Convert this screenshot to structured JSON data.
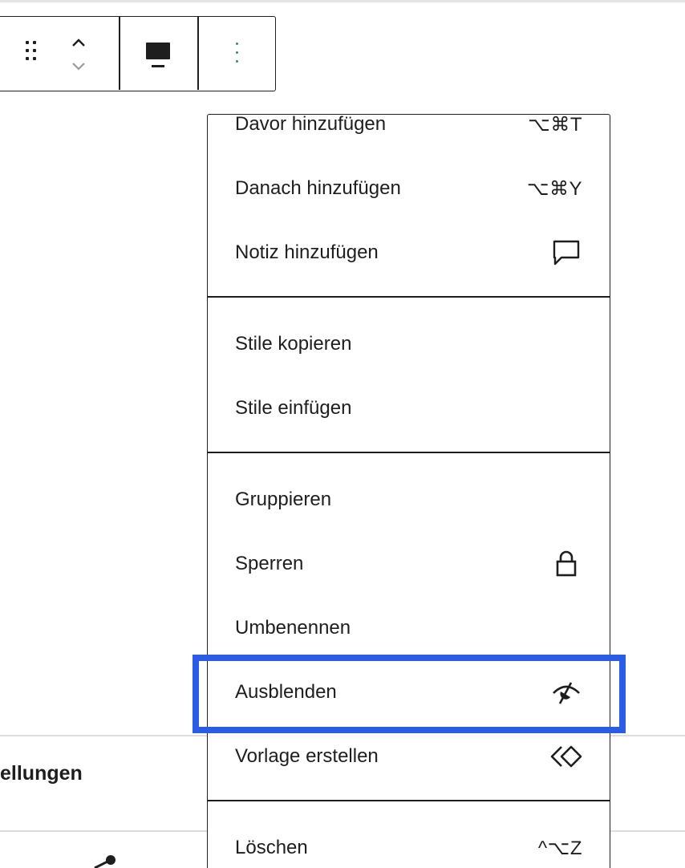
{
  "background": {
    "settings_fragment": "ellungen"
  },
  "toolbar": {
    "drag_icon": "drag-handle-icon",
    "move_up_icon": "chevron-up-icon",
    "move_down_icon": "chevron-down-icon",
    "align_icon": "align-wide-icon",
    "options_icon": "more-vertical-icon"
  },
  "menu": {
    "items": [
      {
        "label": "Davor hinzufügen",
        "shortcut": "⌥⌘T"
      },
      {
        "label": "Danach hinzufügen",
        "shortcut": "⌥⌘Y"
      },
      {
        "label": "Notiz hinzufügen",
        "icon": "comment-icon"
      },
      {
        "label": "Stile kopieren"
      },
      {
        "label": "Stile einfügen"
      },
      {
        "label": "Gruppieren"
      },
      {
        "label": "Sperren",
        "icon": "lock-icon"
      },
      {
        "label": "Umbenennen"
      },
      {
        "label": "Ausblenden",
        "icon": "eye-hidden-icon",
        "highlighted": true
      },
      {
        "label": "Vorlage erstellen",
        "icon": "symbol-icon"
      },
      {
        "label": "Löschen",
        "shortcut": "^⌥Z"
      }
    ]
  },
  "colors": {
    "highlight": "#2b5ce6",
    "text": "#1e1e1e",
    "options_dots": "#3a8a72"
  }
}
